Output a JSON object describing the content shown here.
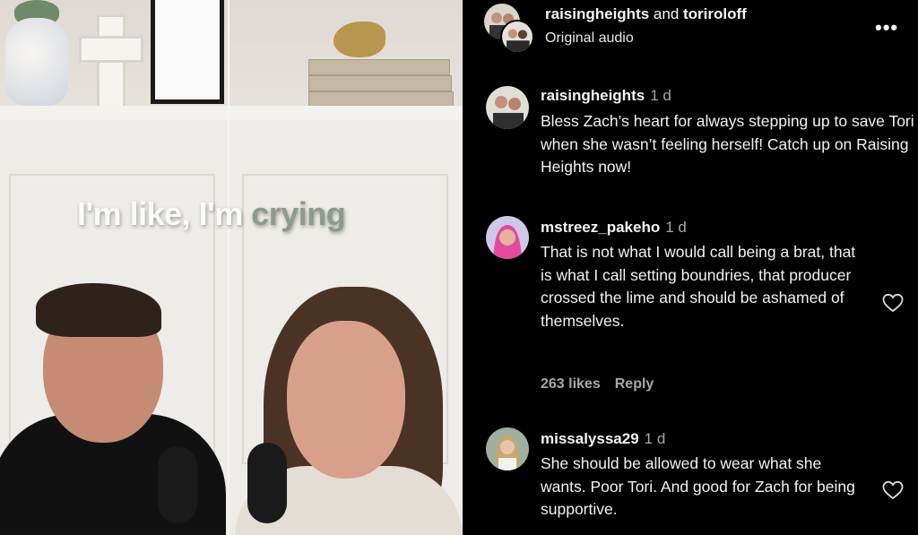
{
  "video": {
    "caption_plain": "I'm like, I'm ",
    "caption_highlight": "crying"
  },
  "post": {
    "authors_primary": "raisingheights",
    "authors_joiner": " and ",
    "authors_secondary": "toriroloff",
    "audio_label": "Original audio",
    "more_icon": "more-horizontal-icon"
  },
  "comments": [
    {
      "username": "raisingheights",
      "time": "1 d",
      "text": "Bless Zach’s heart for always stepping up to save Tori when she wasn’t feeling herself! Catch up on Raising Heights now!",
      "likes": "",
      "reply": ""
    },
    {
      "username": "mstreez_pakeho",
      "time": "1 d",
      "text": "That is not what I would call being a brat, that is what I call setting boundries, that producer crossed the lime and should be ashamed of themselves.",
      "likes": "263 likes",
      "reply": "Reply"
    },
    {
      "username": "missalyssa29",
      "time": "1 d",
      "text": "She should be allowed to wear what she wants. Poor Tori. And good for Zach for being supportive.",
      "likes": "",
      "reply": ""
    }
  ],
  "colors": {
    "background": "#000000",
    "text": "#f5f5f5",
    "muted": "#a8a8a8",
    "caption_highlight": "#8f9a8e"
  }
}
